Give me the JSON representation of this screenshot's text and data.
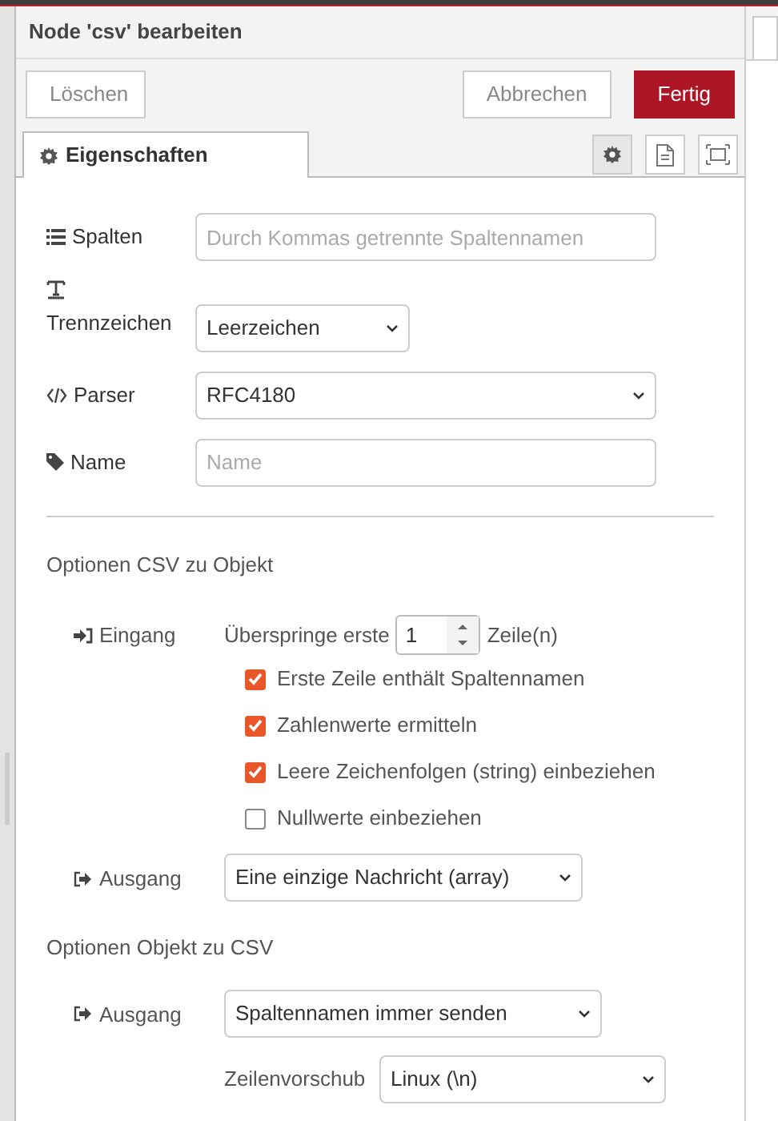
{
  "dialog": {
    "title": "Node 'csv' bearbeiten"
  },
  "buttons": [
    {
      "label": "Löschen",
      "kind": "plain"
    },
    {
      "label": "Abbrechen",
      "kind": "plain"
    },
    {
      "label": "Fertig",
      "kind": "primary"
    }
  ],
  "tabs": [
    {
      "label": "Eigenschaften",
      "selected": true
    }
  ],
  "tab_tools": [
    {
      "kind": "settings",
      "selected": true
    },
    {
      "kind": "document",
      "selected": false
    },
    {
      "kind": "frame",
      "selected": false
    }
  ],
  "form": [
    {
      "label": "Spalten",
      "kind": "text",
      "placeholder": "Durch Kommas getrennte Spaltennamen"
    },
    {
      "label": "Trennzeichen",
      "kind": "select",
      "value": "Leerzeichen"
    },
    {
      "label": "Parser",
      "kind": "select",
      "value": "RFC4180"
    },
    {
      "label": "Name",
      "kind": "text",
      "placeholder": "Name"
    }
  ],
  "csv_to_object": {
    "title": "Optionen CSV zu Objekt",
    "input_label": "Eingang",
    "skip_text": "Überspringe erste",
    "skip_value": "1",
    "skip_suffix": "Zeile(n)",
    "checkboxes": [
      {
        "label": "Erste Zeile enthält Spaltennamen",
        "checked": true
      },
      {
        "label": "Zahlenwerte ermitteln",
        "checked": true
      },
      {
        "label": "Leere Zeichenfolgen (string) einbeziehen",
        "checked": true
      },
      {
        "label": "Nullwerte einbeziehen",
        "checked": false
      }
    ],
    "output_label": "Ausgang",
    "output_value": "Eine einzige Nachricht (array)"
  },
  "object_to_csv": {
    "title": "Optionen Objekt zu CSV",
    "output_label": "Ausgang",
    "output_value": "Spaltennamen immer senden",
    "newline_label": "Zeilenvorschub",
    "newline_value": "Linux (\\n)"
  }
}
